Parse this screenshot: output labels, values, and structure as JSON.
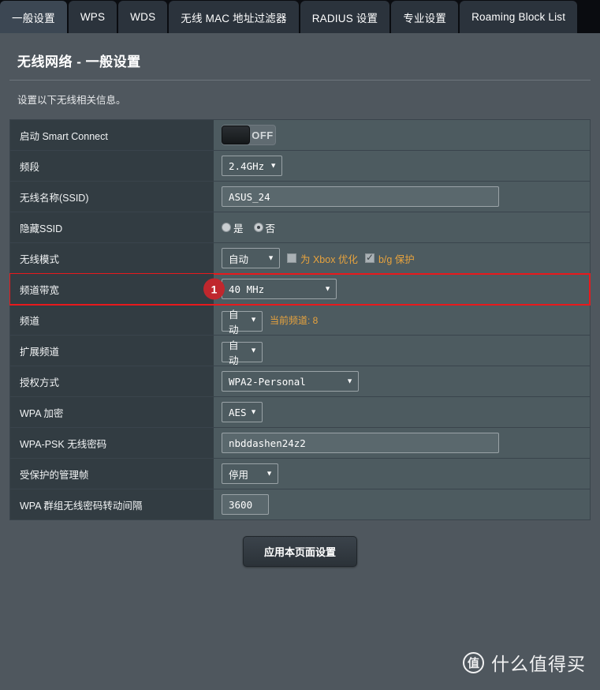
{
  "tabs": [
    {
      "label": "一般设置",
      "active": true
    },
    {
      "label": "WPS",
      "active": false
    },
    {
      "label": "WDS",
      "active": false
    },
    {
      "label": "无线 MAC 地址过滤器",
      "active": false
    },
    {
      "label": "RADIUS 设置",
      "active": false
    },
    {
      "label": "专业设置",
      "active": false
    },
    {
      "label": "Roaming Block List",
      "active": false
    }
  ],
  "header": {
    "title": "无线网络 - 一般设置",
    "description": "设置以下无线相关信息。"
  },
  "form": {
    "smart_connect": {
      "label": "启动 Smart Connect",
      "toggle_state": "OFF"
    },
    "band": {
      "label": "频段",
      "value": "2.4GHz"
    },
    "ssid": {
      "label": "无线名称(SSID)",
      "value": "ASUS_24"
    },
    "hide_ssid": {
      "label": "隐藏SSID",
      "yes": "是",
      "no": "否",
      "selected": "否"
    },
    "wireless_mode": {
      "label": "无线模式",
      "value": "自动",
      "xbox_label": "为 Xbox 优化",
      "xbox_checked": false,
      "bg_label": "b/g 保护",
      "bg_checked": true
    },
    "channel_bandwidth": {
      "label": "频道带宽",
      "value": "40 MHz",
      "badge": "1",
      "highlighted": true
    },
    "channel": {
      "label": "频道",
      "value": "自动",
      "hint": "当前频道: 8"
    },
    "extension_channel": {
      "label": "扩展频道",
      "value": "自动"
    },
    "auth_method": {
      "label": "授权方式",
      "value": "WPA2-Personal"
    },
    "wpa_encryption": {
      "label": "WPA 加密",
      "value": "AES"
    },
    "wpa_psk": {
      "label": "WPA-PSK 无线密码",
      "value": "nbddashen24z2"
    },
    "pmf": {
      "label": "受保护的管理帧",
      "value": "停用"
    },
    "wpa_rekey": {
      "label": "WPA 群组无线密码转动间隔",
      "value": "3600"
    }
  },
  "apply_button": {
    "label": "应用本页面设置"
  },
  "watermark": {
    "logo": "值",
    "text": "什么值得买"
  },
  "colors": {
    "accent_red": "#c0272d",
    "hint_orange": "#e8a33d",
    "label_bg": "#323c42",
    "value_bg": "#4d5b60",
    "page_bg": "#4f575e"
  }
}
